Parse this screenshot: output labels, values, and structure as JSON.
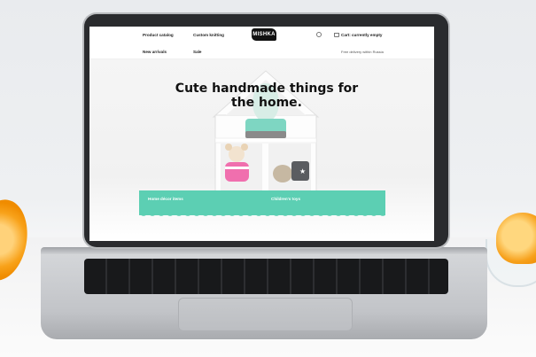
{
  "nav": {
    "product_catalog": "Product catalog",
    "custom_knitting": "Custom knitting",
    "logo": "MISHKA",
    "cart": "Cart: currently empty",
    "new_arrivals": "New arrivals",
    "sale": "Sale",
    "delivery": "Free delivery within Russia"
  },
  "hero": {
    "headline": "Cute handmade things for the home."
  },
  "categories": {
    "home_decor": "Home décor items",
    "childrens_toys": "Children's toys"
  },
  "colors": {
    "accent": "#5ccfb3",
    "cactus_pot": "#7ed6c2",
    "bear_shirt": "#f06fae"
  },
  "icons": [
    "search-icon",
    "cart-icon",
    "logo"
  ]
}
